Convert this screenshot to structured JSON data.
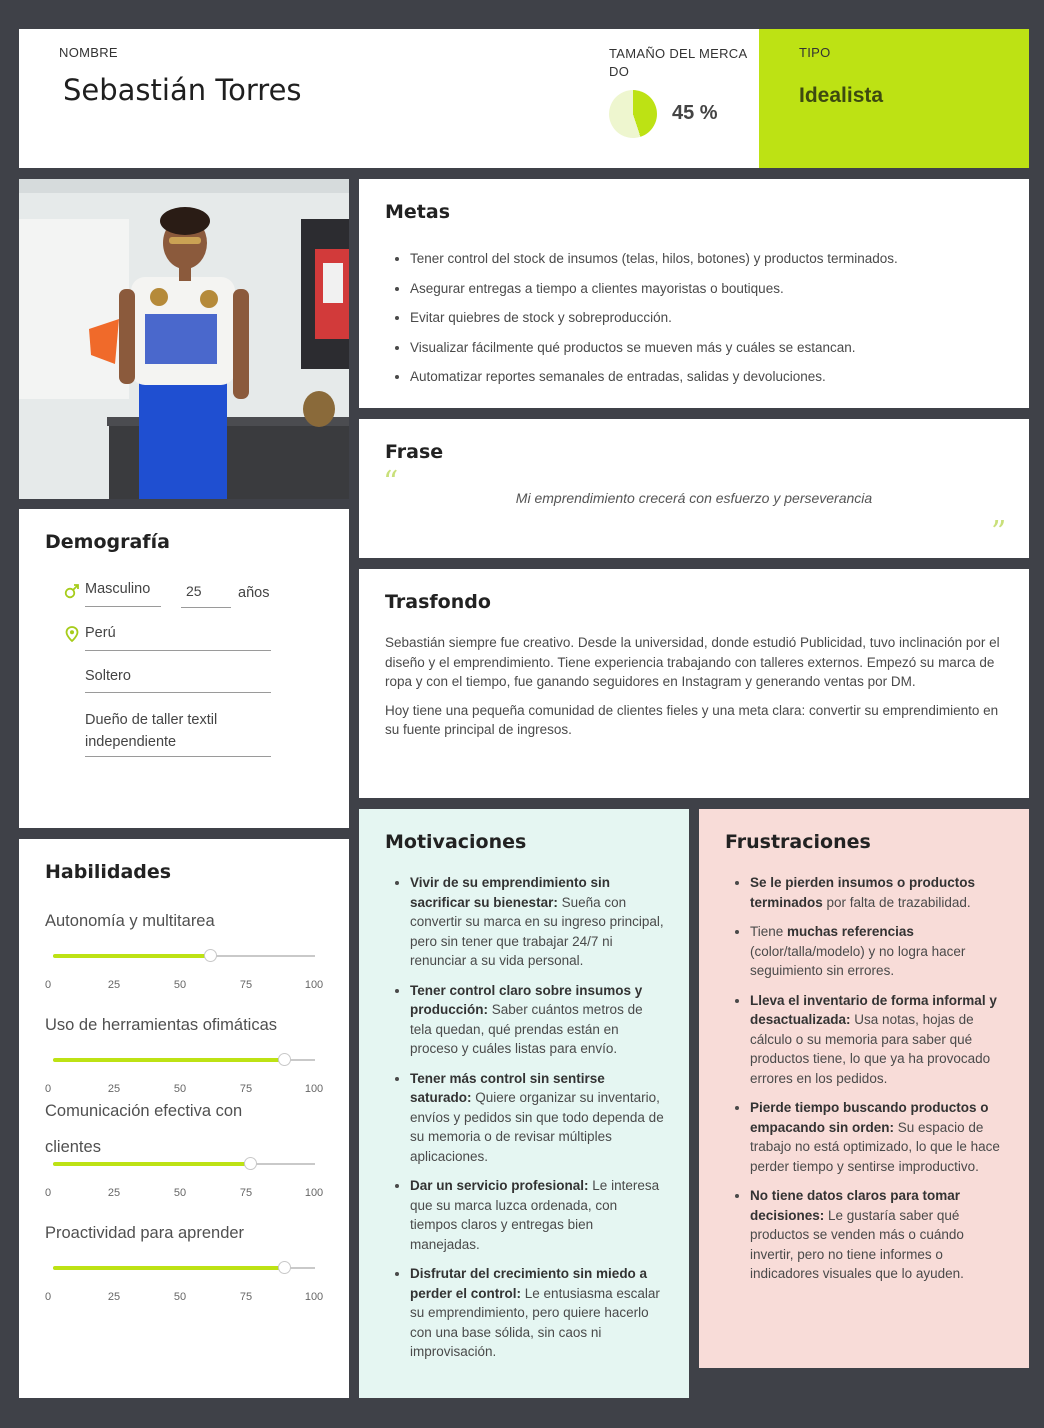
{
  "header": {
    "name_caption": "NOMBRE",
    "name": "Sebastián Torres",
    "market_caption": "TAMAÑO DEL MERCADO",
    "market_percent": 45,
    "market_label": "45 %",
    "type_caption": "TIPO",
    "type_value": "Idealista"
  },
  "colors": {
    "accent": "#bde214",
    "motivations_bg": "#e5f6f2",
    "frustrations_bg": "#f8dcd8",
    "page_bg": "#3f4148"
  },
  "metas": {
    "title": "Metas",
    "items": [
      "Tener control del stock de insumos (telas, hilos, botones) y productos terminados.",
      "Asegurar entregas a tiempo a clientes mayoristas o boutiques.",
      "Evitar quiebres de stock y sobreproducción.",
      "Visualizar fácilmente qué productos se mueven más y cuáles se estancan.",
      "Automatizar reportes semanales de entradas, salidas y devoluciones."
    ]
  },
  "frase": {
    "title": "Frase",
    "text": "Mi emprendimiento crecerá con esfuerzo y perseverancia"
  },
  "trasfondo": {
    "title": "Trasfondo",
    "paragraphs": [
      "Sebastián siempre fue creativo. Desde la universidad, donde estudió Publicidad, tuvo inclinación por el diseño y el emprendimiento. Tiene experiencia trabajando con talleres externos. Empezó su marca de ropa y con el tiempo, fue ganando seguidores en Instagram y generando ventas por DM.",
      "Hoy tiene una pequeña comunidad de clientes fieles y una meta clara: convertir su emprendimiento en su fuente principal de ingresos."
    ]
  },
  "demografia": {
    "title": "Demografía",
    "gender": "Masculino",
    "age": "25",
    "age_unit": "años",
    "country": "Perú",
    "marital_status": "Soltero",
    "occupation": "Dueño de taller textil independiente",
    "icons": [
      "male-icon",
      "location-pin-icon"
    ]
  },
  "habilidades": {
    "title": "Habilidades",
    "scale": [
      "0",
      "25",
      "50",
      "75",
      "100"
    ],
    "skills": [
      {
        "name": "Autonomía y multitarea",
        "value": 60
      },
      {
        "name": "Uso de herramientas ofimáticas",
        "value": 88
      },
      {
        "name": "Comunicación efectiva con clientes",
        "value": 75
      },
      {
        "name": "Proactividad para aprender",
        "value": 88
      }
    ]
  },
  "motivaciones": {
    "title": "Motivaciones",
    "items": [
      {
        "bold": "Vivir de su emprendimiento sin sacrificar su bienestar:",
        "text": " Sueña con convertir su marca en su ingreso principal, pero sin tener que trabajar 24/7 ni renunciar a su vida personal."
      },
      {
        "bold": "Tener control claro sobre insumos y producción:",
        "text": " Saber cuántos metros de tela quedan, qué prendas están en proceso y cuáles listas para envío."
      },
      {
        "bold": "Tener más control sin sentirse saturado:",
        "text": " Quiere organizar su inventario, envíos y pedidos sin que todo dependa de su memoria o de revisar múltiples aplicaciones."
      },
      {
        "bold": "Dar un servicio profesional:",
        "text": " Le interesa que su marca luzca ordenada, con tiempos claros y entregas bien manejadas."
      },
      {
        "bold": "Disfrutar del crecimiento sin miedo a perder el control:",
        "text": " Le entusiasma escalar su emprendimiento, pero quiere hacerlo con una base sólida, sin caos ni improvisación."
      }
    ]
  },
  "frustraciones": {
    "title": "Frustraciones",
    "items": [
      {
        "pre": "",
        "bold": "Se le pierden insumos o productos terminados",
        "text": " por falta de trazabilidad."
      },
      {
        "pre": "Tiene ",
        "bold": "muchas referencias",
        "text": " (color/talla/modelo) y no logra hacer seguimiento sin errores."
      },
      {
        "pre": "",
        "bold": "Lleva el inventario de forma informal y desactualizada:",
        "text": " Usa notas, hojas de cálculo o su memoria para saber qué productos tiene, lo que ya ha provocado errores en los pedidos."
      },
      {
        "pre": "",
        "bold": "Pierde tiempo buscando productos o empacando sin orden:",
        "text": " Su espacio de trabajo no está optimizado, lo que le hace perder tiempo y sentirse improductivo."
      },
      {
        "pre": "",
        "bold": "No tiene datos claros para tomar decisiones:",
        "text": " Le gustaría saber qué productos se venden más o cuándo invertir, pero no tiene informes o indicadores visuales que lo ayuden."
      }
    ]
  }
}
